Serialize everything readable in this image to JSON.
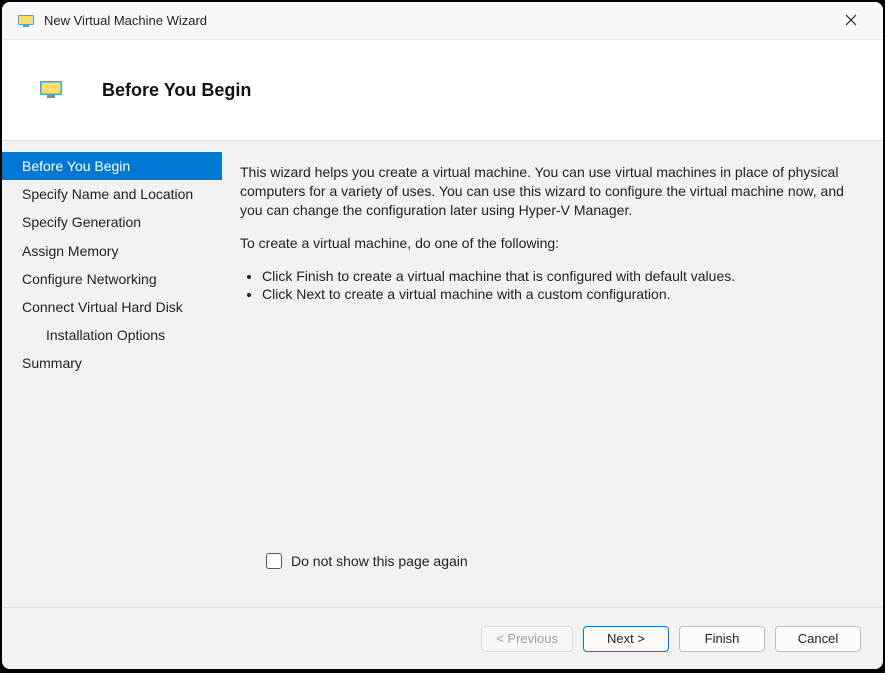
{
  "titlebar": {
    "title": "New Virtual Machine Wizard"
  },
  "header": {
    "title": "Before You Begin"
  },
  "sidebar": {
    "items": [
      {
        "label": "Before You Begin",
        "active": true,
        "indent": false
      },
      {
        "label": "Specify Name and Location",
        "active": false,
        "indent": false
      },
      {
        "label": "Specify Generation",
        "active": false,
        "indent": false
      },
      {
        "label": "Assign Memory",
        "active": false,
        "indent": false
      },
      {
        "label": "Configure Networking",
        "active": false,
        "indent": false
      },
      {
        "label": "Connect Virtual Hard Disk",
        "active": false,
        "indent": false
      },
      {
        "label": "Installation Options",
        "active": false,
        "indent": true
      },
      {
        "label": "Summary",
        "active": false,
        "indent": false
      }
    ]
  },
  "main": {
    "para1": "This wizard helps you create a virtual machine. You can use virtual machines in place of physical computers for a variety of uses. You can use this wizard to configure the virtual machine now, and you can change the configuration later using Hyper-V Manager.",
    "para2": "To create a virtual machine, do one of the following:",
    "bullet1": "Click Finish to create a virtual machine that is configured with default values.",
    "bullet2": "Click Next to create a virtual machine with a custom configuration.",
    "checkbox_label": "Do not show this page again"
  },
  "buttons": {
    "previous": "< Previous",
    "next": "Next >",
    "finish": "Finish",
    "cancel": "Cancel"
  }
}
